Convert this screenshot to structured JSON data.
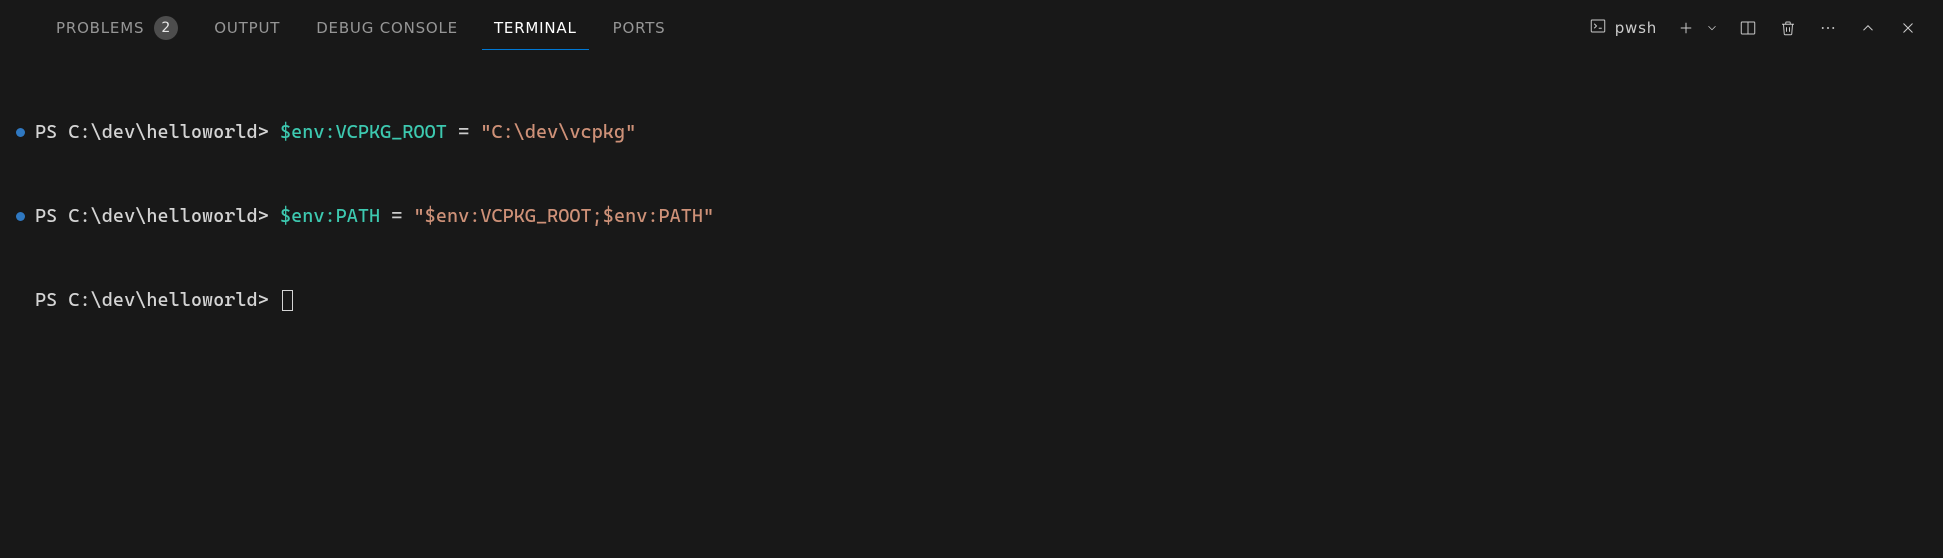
{
  "tabs": {
    "problems": {
      "label": "PROBLEMS",
      "badge": "2"
    },
    "output": {
      "label": "OUTPUT"
    },
    "debug": {
      "label": "DEBUG CONSOLE"
    },
    "terminal": {
      "label": "TERMINAL"
    },
    "ports": {
      "label": "PORTS"
    }
  },
  "active_tab": "terminal",
  "shell": {
    "name": "pwsh"
  },
  "terminal": {
    "lines": [
      {
        "has_dot": true,
        "prompt": "PS C:\\dev\\helloworld>",
        "var": "$env:VCPKG_ROOT",
        "eq": " = ",
        "str": "\"C:\\dev\\vcpkg\""
      },
      {
        "has_dot": true,
        "prompt": "PS C:\\dev\\helloworld>",
        "var": "$env:PATH",
        "eq": " = ",
        "str": "\"$env:VCPKG_ROOT;$env:PATH\""
      },
      {
        "has_dot": false,
        "prompt": "PS C:\\dev\\helloworld>",
        "var": "",
        "eq": "",
        "str": "",
        "cursor": true
      }
    ]
  }
}
